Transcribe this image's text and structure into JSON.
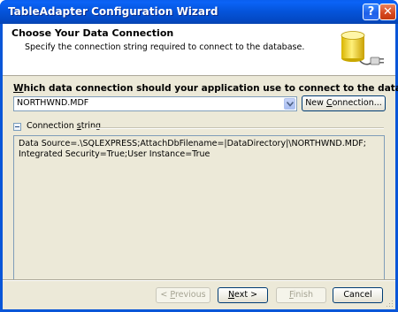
{
  "window": {
    "title": "TableAdapter Configuration Wizard",
    "help_glyph": "?",
    "close_glyph": "✕"
  },
  "header": {
    "title": "Choose Your Data Connection",
    "subtitle": "Specify the connection string required to connect to the database.",
    "icon": "database-plug-icon"
  },
  "question": {
    "label_underlined": "W",
    "label_rest": "hich data connection should your application use to connect to the database?"
  },
  "connection_select": {
    "selected_value": "NORTHWND.MDF"
  },
  "new_connection_button": {
    "mnemonic": "C",
    "prefix": "New ",
    "suffix": "onnection..."
  },
  "connection_string_group": {
    "label_prefix": "Connection ",
    "label_mnemonic": "s",
    "label_suffix": "tring",
    "value": "Data Source=.\\SQLEXPRESS;AttachDbFilename=|DataDirectory|\\NORTHWND.MDF;Integrated Security=True;User Instance=True"
  },
  "footer": {
    "previous": {
      "prefix": "< ",
      "mnemonic": "P",
      "suffix": "revious"
    },
    "next": {
      "mnemonic": "N",
      "suffix": "ext >"
    },
    "finish": {
      "mnemonic": "F",
      "suffix": "inish"
    },
    "cancel": "Cancel"
  },
  "colors": {
    "titlebar": "#0453d9",
    "client_bg": "#ece9d8",
    "button_border": "#003c74"
  }
}
